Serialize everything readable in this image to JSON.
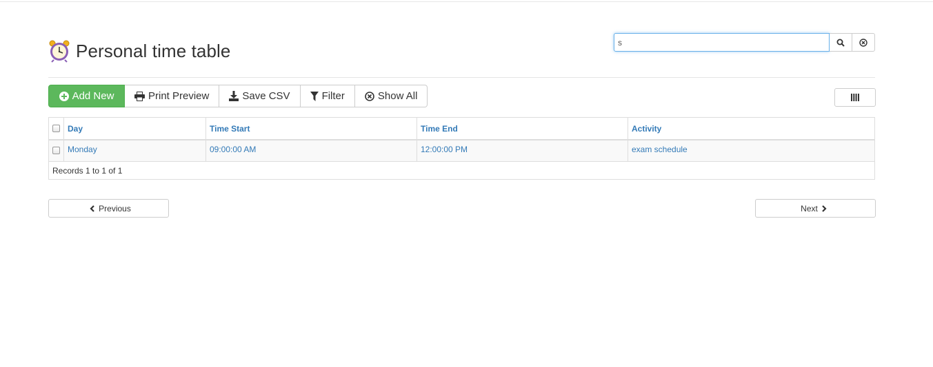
{
  "header": {
    "title": "Personal time table",
    "icon": "alarm-clock-icon"
  },
  "search": {
    "value": "s",
    "search_icon": "search-icon",
    "clear_icon": "clear-circle-icon"
  },
  "toolbar": {
    "add_new": "Add New",
    "print_preview": "Print Preview",
    "save_csv": "Save CSV",
    "filter": "Filter",
    "show_all": "Show All",
    "add_color": "#5cb85c"
  },
  "table": {
    "columns": [
      "Day",
      "Time Start",
      "Time End",
      "Activity"
    ],
    "rows": [
      {
        "day": "Monday",
        "time_start": "09:00:00 AM",
        "time_end": "12:00:00 PM",
        "activity": "exam schedule"
      }
    ],
    "footer": "Records 1 to 1 of 1",
    "link_color": "#337ab7"
  },
  "pager": {
    "previous": "Previous",
    "next": "Next"
  }
}
